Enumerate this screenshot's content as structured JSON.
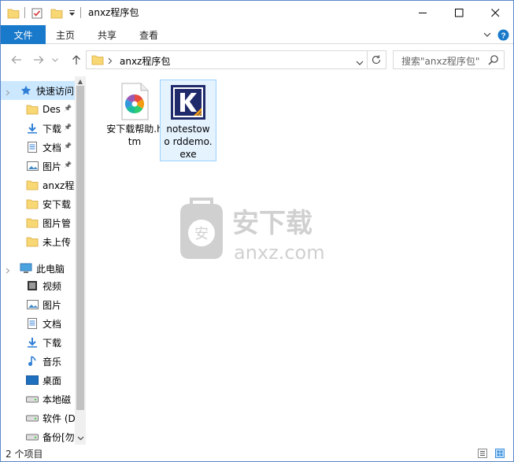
{
  "title": "anxz程序包",
  "window_buttons": {
    "minimize": "—",
    "maximize": "☐",
    "close": "✕"
  },
  "ribbon": {
    "file_tab": "文件",
    "tabs": [
      "主页",
      "共享",
      "查看"
    ]
  },
  "address": {
    "path": "anxz程序包"
  },
  "search": {
    "placeholder": "搜索\"anxz程序包\""
  },
  "nav_pane": {
    "items": [
      {
        "label": "快速访问",
        "icon": "star-icon",
        "selected": true
      },
      {
        "label": "Des",
        "icon": "folder-icon",
        "pinned": true
      },
      {
        "label": "下载",
        "icon": "download-icon",
        "pinned": true
      },
      {
        "label": "文档",
        "icon": "document-icon",
        "pinned": true
      },
      {
        "label": "图片",
        "icon": "picture-icon",
        "pinned": true
      },
      {
        "label": "anxz程",
        "icon": "folder-icon"
      },
      {
        "label": "安下载",
        "icon": "folder-icon"
      },
      {
        "label": "图片管",
        "icon": "folder-icon"
      },
      {
        "label": "未上传",
        "icon": "folder-icon"
      },
      {
        "label": "此电脑",
        "icon": "computer-icon"
      },
      {
        "label": "视频",
        "icon": "video-icon"
      },
      {
        "label": "图片",
        "icon": "picture-icon"
      },
      {
        "label": "文档",
        "icon": "document-icon"
      },
      {
        "label": "下载",
        "icon": "download-icon"
      },
      {
        "label": "音乐",
        "icon": "music-icon"
      },
      {
        "label": "桌面",
        "icon": "desktop-icon"
      },
      {
        "label": "本地磁",
        "icon": "drive-icon"
      },
      {
        "label": "软件 (D",
        "icon": "drive-icon"
      },
      {
        "label": "备份[勿",
        "icon": "drive-icon"
      }
    ]
  },
  "files": [
    {
      "name": "安下载帮助.htm",
      "icon": "htm-file-icon"
    },
    {
      "name": "notestowo rddemo.exe",
      "icon": "exe-file-icon",
      "selected": true
    }
  ],
  "watermark": {
    "text": "安下载",
    "subtext": "anxz.com"
  },
  "status": {
    "count": "2 个项目"
  },
  "colors": {
    "accent": "#1979ca",
    "selection": "#cce8ff",
    "folder": "#f8d775"
  }
}
